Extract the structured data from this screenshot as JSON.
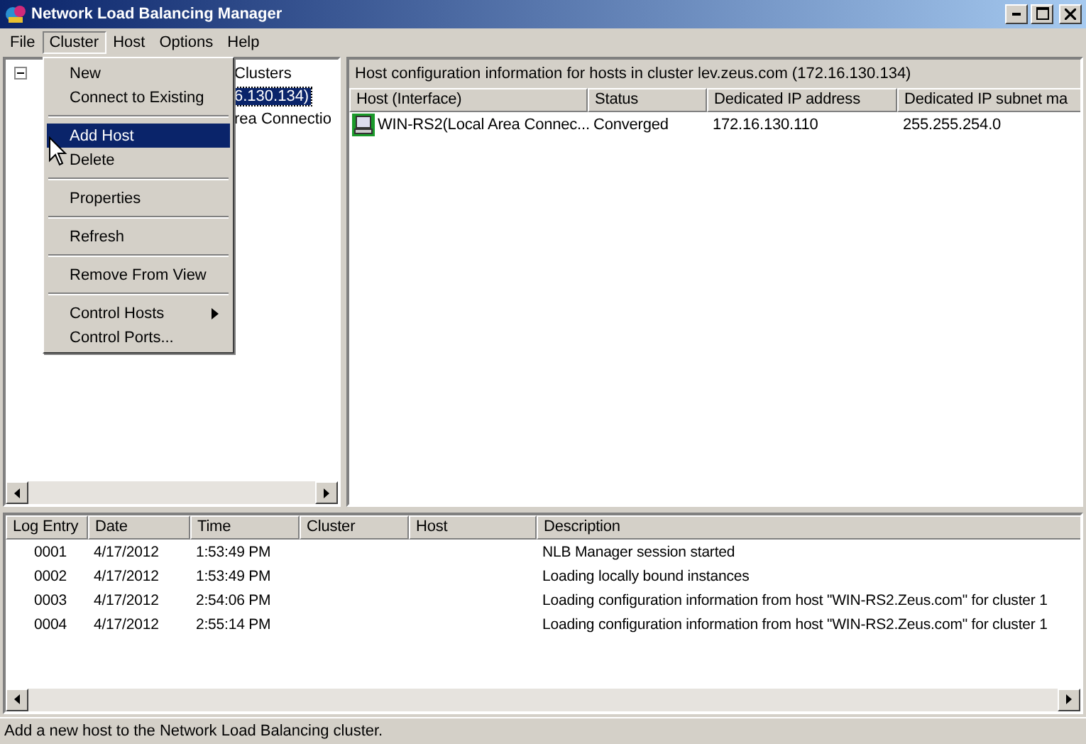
{
  "window": {
    "title": "Network Load Balancing Manager"
  },
  "menu_bar": [
    {
      "label": "File",
      "selected": false
    },
    {
      "label": "Cluster",
      "selected": true
    },
    {
      "label": "Host",
      "selected": false
    },
    {
      "label": "Options",
      "selected": false
    },
    {
      "label": "Help",
      "selected": false
    }
  ],
  "cluster_menu": [
    {
      "kind": "item",
      "label": "New",
      "selected": false,
      "submenu": false
    },
    {
      "kind": "item",
      "label": "Connect to Existing",
      "selected": false,
      "submenu": false
    },
    {
      "kind": "separator"
    },
    {
      "kind": "item",
      "label": "Add Host",
      "selected": true,
      "submenu": false
    },
    {
      "kind": "item",
      "label": "Delete",
      "selected": false,
      "submenu": false
    },
    {
      "kind": "separator"
    },
    {
      "kind": "item",
      "label": "Properties",
      "selected": false,
      "submenu": false
    },
    {
      "kind": "separator"
    },
    {
      "kind": "item",
      "label": "Refresh",
      "selected": false,
      "submenu": false
    },
    {
      "kind": "separator"
    },
    {
      "kind": "item",
      "label": "Remove From View",
      "selected": false,
      "submenu": false
    },
    {
      "kind": "separator"
    },
    {
      "kind": "item",
      "label": "Control Hosts",
      "selected": false,
      "submenu": true
    },
    {
      "kind": "item",
      "label": "Control Ports...",
      "selected": false,
      "submenu": false
    }
  ],
  "tree": [
    {
      "label": "Clusters",
      "expanded": true,
      "selected": false,
      "children": [
        {
          "label": "6.130.134)",
          "selected": true,
          "children": [
            {
              "label": "rea Connectio",
              "selected": false
            }
          ]
        }
      ]
    }
  ],
  "host_panel": {
    "heading": "Host configuration information for hosts in cluster lev.zeus.com (172.16.130.134)",
    "columns": [
      "Host (Interface)",
      "Status",
      "Dedicated IP address",
      "Dedicated IP subnet ma"
    ],
    "rows": [
      [
        "WIN-RS2(Local Area Connec...",
        "Converged",
        "172.16.130.110",
        "255.255.254.0"
      ]
    ]
  },
  "log": {
    "columns": [
      "Log Entry",
      "Date",
      "Time",
      "Cluster",
      "Host",
      "Description"
    ],
    "rows": [
      [
        "0001",
        "4/17/2012",
        "1:53:49 PM",
        "",
        "",
        "NLB Manager session started"
      ],
      [
        "0002",
        "4/17/2012",
        "1:53:49 PM",
        "",
        "",
        "Loading locally bound instances"
      ],
      [
        "0003",
        "4/17/2012",
        "2:54:06 PM",
        "",
        "",
        "Loading configuration information from host \"WIN-RS2.Zeus.com\" for cluster 1"
      ],
      [
        "0004",
        "4/17/2012",
        "2:55:14 PM",
        "",
        "",
        "Loading configuration information from host \"WIN-RS2.Zeus.com\" for cluster 1"
      ]
    ]
  },
  "status_bar": "Add a new host to the Network Load Balancing cluster."
}
